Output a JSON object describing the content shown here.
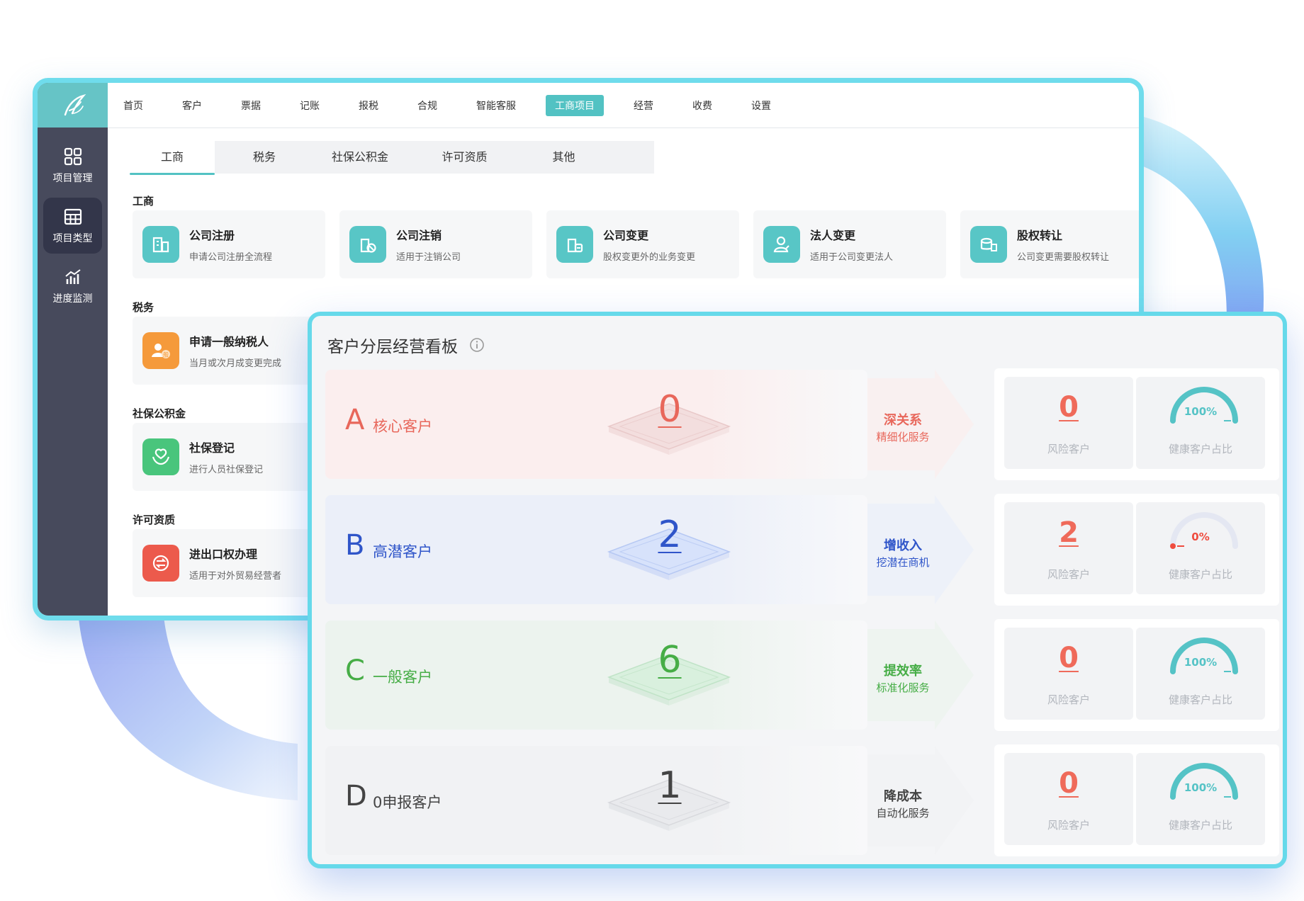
{
  "topnav": {
    "items": [
      "首页",
      "客户",
      "票据",
      "记账",
      "报税",
      "合规",
      "智能客服",
      "工商项目",
      "经营",
      "收费",
      "设置"
    ],
    "active_index": 7
  },
  "sidebar": {
    "items": [
      {
        "label": "项目管理",
        "icon": "grid-icon"
      },
      {
        "label": "项目类型",
        "icon": "table-icon"
      },
      {
        "label": "进度监测",
        "icon": "bar-chart-icon"
      }
    ],
    "active_index": 1
  },
  "subtabs": {
    "items": [
      "工商",
      "税务",
      "社保公积金",
      "许可资质",
      "其他"
    ],
    "active_index": 0
  },
  "sections": [
    {
      "title": "工商",
      "cards": [
        {
          "title": "公司注册",
          "desc": "申请公司注册全流程",
          "icon": "building-icon"
        },
        {
          "title": "公司注销",
          "desc": "适用于注销公司",
          "icon": "cancel-company-icon"
        },
        {
          "title": "公司变更",
          "desc": "股权变更外的业务变更",
          "icon": "company-change-icon"
        },
        {
          "title": "法人变更",
          "desc": "适用于公司变更法人",
          "icon": "legal-person-icon"
        },
        {
          "title": "股权转让",
          "desc": "公司变更需要股权转让",
          "icon": "equity-transfer-icon"
        }
      ]
    },
    {
      "title": "税务",
      "cards": [
        {
          "title": "申请一般纳税人",
          "desc": "当月或次月成变更完成",
          "icon": "taxpayer-icon"
        }
      ]
    },
    {
      "title": "社保公积金",
      "cards": [
        {
          "title": "社保登记",
          "desc": "进行人员社保登记",
          "icon": "social-security-icon"
        }
      ]
    },
    {
      "title": "许可资质",
      "cards": [
        {
          "title": "进出口权办理",
          "desc": "适用于对外贸易经营者",
          "icon": "import-export-icon"
        }
      ]
    }
  ],
  "dashboard": {
    "title": "客户分层经营看板",
    "segments": [
      {
        "letter": "A",
        "label": "核心客户",
        "count": "0",
        "tag1": "深关系",
        "tag2": "精细化服务",
        "risk": "0",
        "risk_label": "风险客户",
        "health_pct": "100%",
        "health_value": 1.0,
        "health_label": "健康客户占比",
        "color": "#e8675b",
        "bg": "#fbeeee",
        "plate": "#f3dede",
        "plate_edge": "#e9c9c9"
      },
      {
        "letter": "B",
        "label": "高潜客户",
        "count": "2",
        "tag1": "增收入",
        "tag2": "挖潜在商机",
        "risk": "2",
        "risk_label": "风险客户",
        "health_pct": "0%",
        "health_value": 0.0,
        "health_label": "健康客户占比",
        "color": "#2f55c9",
        "bg": "#ebeff9",
        "plate": "#d7e2fb",
        "plate_edge": "#b6c8f3"
      },
      {
        "letter": "C",
        "label": "一般客户",
        "count": "6",
        "tag1": "提效率",
        "tag2": "标准化服务",
        "risk": "0",
        "risk_label": "风险客户",
        "health_pct": "100%",
        "health_value": 1.0,
        "health_label": "健康客户占比",
        "color": "#46ad46",
        "bg": "#ecf3ee",
        "plate": "#d9f0de",
        "plate_edge": "#c0e3c7"
      },
      {
        "letter": "D",
        "label": "0申报客户",
        "count": "1",
        "tag1": "降成本",
        "tag2": "自动化服务",
        "risk": "0",
        "risk_label": "风险客户",
        "health_pct": "100%",
        "health_value": 1.0,
        "health_label": "健康客户占比",
        "color": "#444444",
        "bg": "#f1f2f4",
        "plate": "#e9eaed",
        "plate_edge": "#d8d9dd"
      }
    ]
  }
}
